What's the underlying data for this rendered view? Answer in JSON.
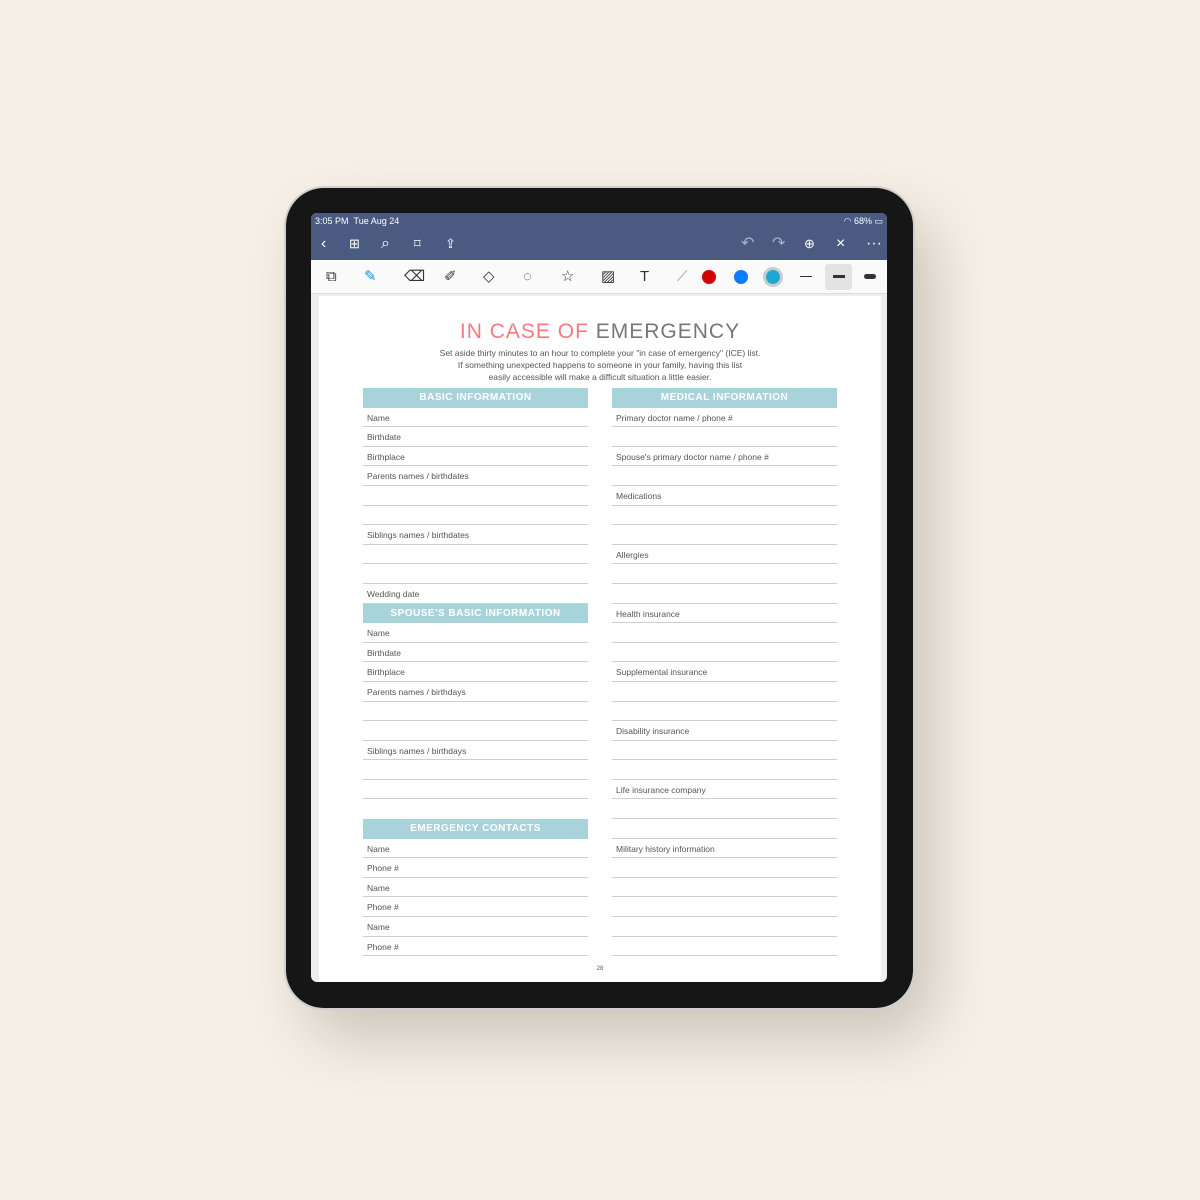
{
  "status": {
    "time": "3:05 PM",
    "date": "Tue Aug 24",
    "battery": "68%"
  },
  "nav": {
    "icons": [
      "back-icon",
      "grid-icon",
      "search-icon",
      "bookmark-icon",
      "share-icon",
      "undo-icon",
      "redo-icon",
      "add-page-icon",
      "close-icon",
      "more-icon"
    ]
  },
  "toolbar": {
    "colors": [
      "#d40000",
      "#0a7cff",
      "#1fa8d6"
    ],
    "tools": [
      "pages-icon",
      "pen-icon",
      "eraser-icon",
      "highlighter-icon",
      "shapes-icon",
      "lasso-icon",
      "sticker-icon",
      "image-icon",
      "text-icon",
      "laser-icon"
    ]
  },
  "page": {
    "title_a": "IN CASE OF",
    "title_b": "EMERGENCY",
    "intro": [
      "Set aside thirty minutes to an hour to complete your \"in case of emergency\" (ICE) list.",
      "If something unexpected happens to someone in your family, having this list",
      "easily accessible will make a difficult situation a little easier."
    ],
    "page_number": "28",
    "accent": "#a9d3da",
    "left": [
      {
        "header": "BASIC INFORMATION",
        "rows": [
          "Name",
          "Birthdate",
          "Birthplace",
          "Parents names / birthdates",
          "",
          "",
          "Siblings names / birthdates",
          "",
          "",
          "Wedding date"
        ]
      },
      {
        "header": "SPOUSE'S BASIC INFORMATION",
        "rows": [
          "Name",
          "Birthdate",
          "Birthplace",
          "Parents names / birthdays",
          "",
          "",
          "Siblings names / birthdays",
          "",
          ""
        ]
      },
      {
        "header": "EMERGENCY CONTACTS",
        "rows": [
          "Name",
          "Phone #",
          "Name",
          "Phone #",
          "Name",
          "Phone #"
        ]
      }
    ],
    "right": {
      "header": "MEDICAL INFORMATION",
      "rows": [
        "Primary doctor name / phone #",
        "",
        "Spouse's primary doctor name / phone #",
        "",
        "Medications",
        "",
        "",
        "Allergies",
        "",
        "",
        "Health insurance",
        "",
        "",
        "Supplemental insurance",
        "",
        "",
        "Disability insurance",
        "",
        "",
        "Life insurance company",
        "",
        "",
        "Military history information",
        "",
        "",
        "",
        "",
        ""
      ]
    }
  }
}
